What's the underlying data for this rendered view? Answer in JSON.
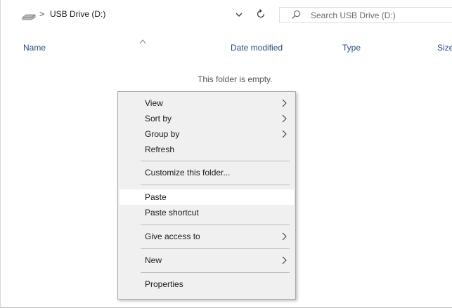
{
  "address_bar": {
    "drive_icon": "usb-drive-icon",
    "separator": ">",
    "path": "USB Drive (D:)",
    "dropdown_icon": "chevron-down-icon",
    "refresh_icon": "refresh-icon"
  },
  "search": {
    "icon": "search-icon",
    "placeholder": "Search USB Drive (D:)",
    "value": ""
  },
  "columns": {
    "name": "Name",
    "date_modified": "Date modified",
    "type": "Type",
    "size": "Size",
    "sort_indicator": "sort-ascending-icon"
  },
  "content": {
    "empty_message": "This folder is empty."
  },
  "context_menu": {
    "items": [
      {
        "label": "View",
        "submenu": true
      },
      {
        "label": "Sort by",
        "submenu": true
      },
      {
        "label": "Group by",
        "submenu": true
      },
      {
        "label": "Refresh",
        "submenu": false
      },
      {
        "label": "Customize this folder...",
        "submenu": false
      },
      {
        "label": "Paste",
        "submenu": false,
        "highlighted": true
      },
      {
        "label": "Paste shortcut",
        "submenu": false
      },
      {
        "label": "Give access to",
        "submenu": true
      },
      {
        "label": "New",
        "submenu": true
      },
      {
        "label": "Properties",
        "submenu": false
      }
    ]
  },
  "colors": {
    "column_header_text": "#2b4b7a",
    "menu_background": "#f0f0f0",
    "menu_highlight": "#ffffff"
  }
}
